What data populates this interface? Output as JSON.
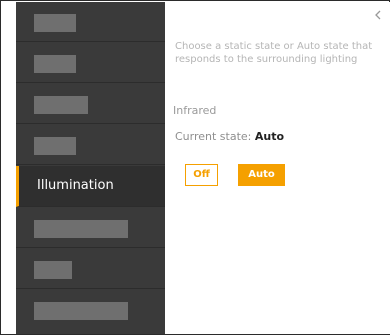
{
  "sidebar": {
    "items": [
      {
        "label": "",
        "redacted": true
      },
      {
        "label": "",
        "redacted": true
      },
      {
        "label": "",
        "redacted": true
      },
      {
        "label": "",
        "redacted": true
      },
      {
        "label": "Illumination",
        "active": true
      },
      {
        "label": "",
        "redacted": true
      },
      {
        "label": "",
        "redacted": true
      },
      {
        "label": "",
        "redacted": true
      }
    ]
  },
  "content": {
    "collapse_icon": "chevron-left-icon",
    "description": "Choose a static state or Auto state that responds to the surrounding lighting",
    "section_title": "Infrared",
    "current_state_label": "Current state: ",
    "current_state_value": "Auto",
    "buttons": {
      "off_label": "Off",
      "auto_label": "Auto"
    }
  },
  "colors": {
    "accent": "#f5a000",
    "sidebar_bg": "#3a3a3a",
    "active_bg": "#2f2f2f"
  }
}
